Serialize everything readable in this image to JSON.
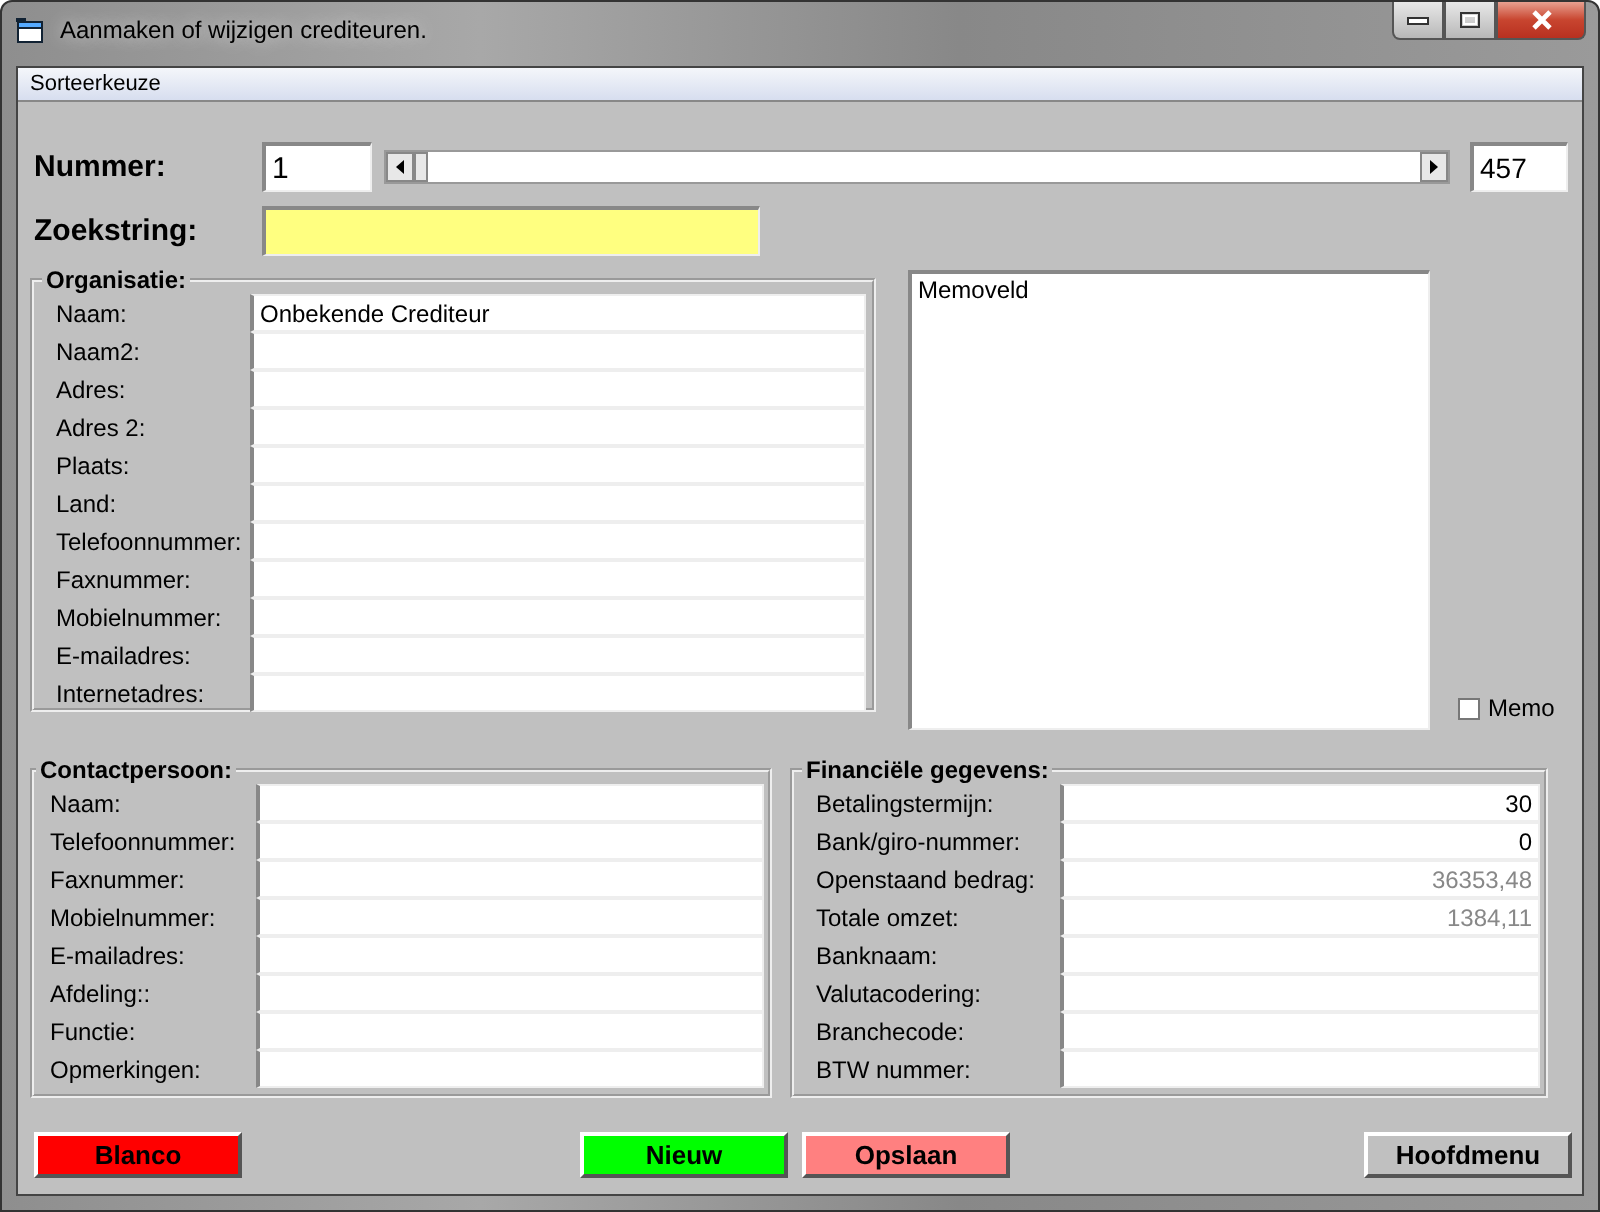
{
  "window": {
    "title": "Aanmaken of wijzigen crediteuren."
  },
  "menu": [
    {
      "label": "Sorteerkeuze"
    }
  ],
  "nummer": {
    "label": "Nummer:",
    "value": "1",
    "total": "457"
  },
  "zoekstring": {
    "label": "Zoekstring:"
  },
  "organisatie": {
    "title": "Organisatie:",
    "fields": [
      {
        "label": "Naam:",
        "value": "Onbekende Crediteur"
      },
      {
        "label": "Naam2:"
      },
      {
        "label": "Adres:"
      },
      {
        "label": "Adres 2:"
      },
      {
        "label": "Plaats:"
      },
      {
        "label": "Land:"
      },
      {
        "label": "Telefoonnummer:"
      },
      {
        "label": "Faxnummer:"
      },
      {
        "label": "Mobielnummer:"
      },
      {
        "label": "E-mailadres:"
      },
      {
        "label": "Internetadres:"
      }
    ]
  },
  "memo": {
    "value": "Memoveld",
    "checkbox": {
      "label": "Memo",
      "checked": false
    }
  },
  "contactpersoon": {
    "title": "Contactpersoon:",
    "fields": [
      {
        "label": "Naam:"
      },
      {
        "label": "Telefoonnummer:"
      },
      {
        "label": "Faxnummer:"
      },
      {
        "label": "Mobielnummer:"
      },
      {
        "label": "E-mailadres:"
      },
      {
        "label": "Afdeling::"
      },
      {
        "label": "Functie:"
      },
      {
        "label": "Opmerkingen:"
      }
    ]
  },
  "financieel": {
    "title": "Financiële gegevens:",
    "fields": [
      {
        "label": "Betalingstermijn:",
        "value": "30",
        "disabled": false
      },
      {
        "label": "Bank/giro-nummer:",
        "value": "0",
        "disabled": false
      },
      {
        "label": "Openstaand bedrag:",
        "value": "36353,48",
        "disabled": true
      },
      {
        "label": "Totale omzet:",
        "value": "1384,11",
        "disabled": true
      },
      {
        "label": "Banknaam:"
      },
      {
        "label": "Valutacodering:"
      },
      {
        "label": "Branchecode:"
      },
      {
        "label": "BTW nummer:"
      }
    ]
  },
  "buttons": [
    {
      "label": "Blanco",
      "color": "#ff0000"
    },
    {
      "label": "Nieuw",
      "color": "#00ff00"
    },
    {
      "label": "Opslaan",
      "color": "#ff8080"
    },
    {
      "label": "Hoofdmenu",
      "color": "#c0c0c0"
    }
  ]
}
